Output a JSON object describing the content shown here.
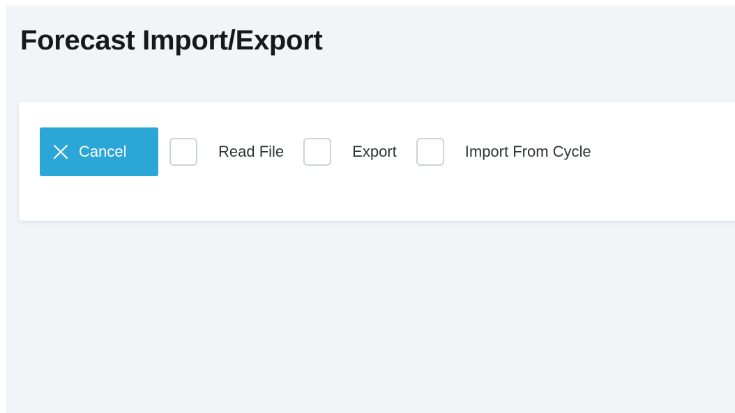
{
  "page": {
    "title": "Forecast Import/Export"
  },
  "toolbar": {
    "cancel_label": "Cancel",
    "cancel_icon": "close-icon",
    "options": [
      {
        "label": "Read File",
        "checked": false
      },
      {
        "label": "Export",
        "checked": false
      },
      {
        "label": "Import From Cycle",
        "checked": false
      }
    ]
  },
  "colors": {
    "accent": "#2ba6d6",
    "page_background": "#f2f5f8",
    "card_background": "#ffffff",
    "checkbox_border": "#cdd3da"
  }
}
